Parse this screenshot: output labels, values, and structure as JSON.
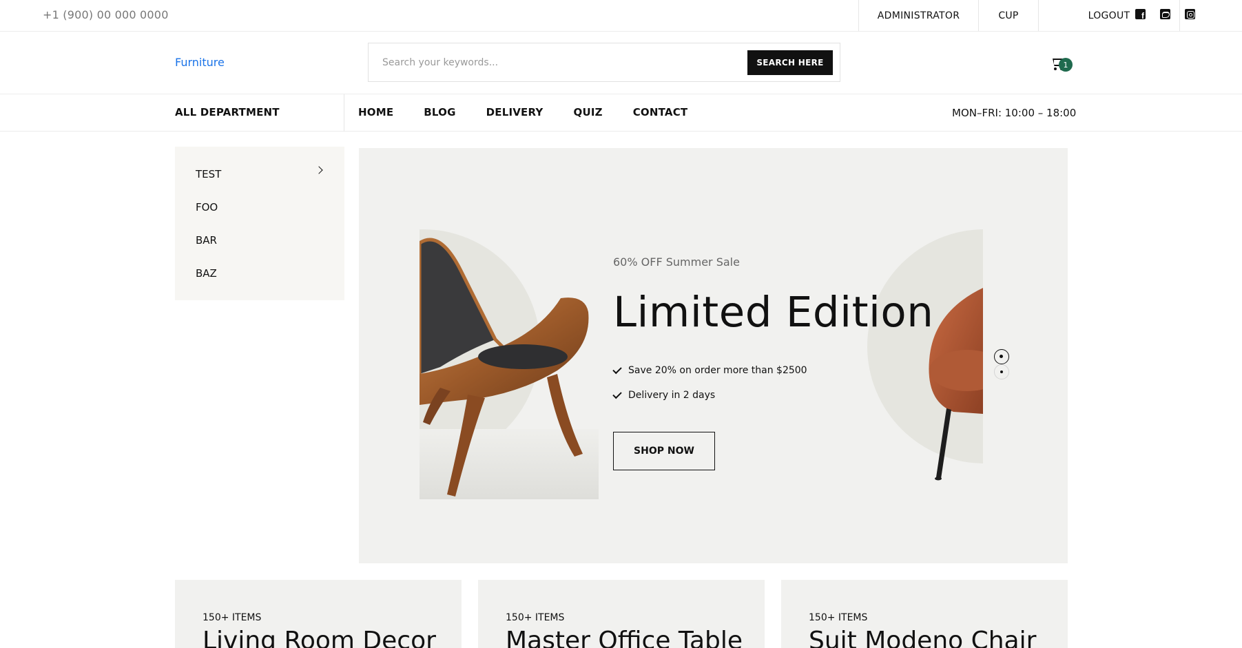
{
  "topbar": {
    "phone": "+1 (900) 00 000 0000",
    "links": {
      "admin": "ADMINISTRATOR",
      "cup": "CUP",
      "logout": "LOGOUT"
    },
    "socials": [
      "facebook-icon",
      "twitter-icon",
      "instagram-icon"
    ]
  },
  "header": {
    "logo": "Furniture",
    "search": {
      "placeholder": "Search your keywords...",
      "button": "SEARCH HERE"
    },
    "cart": {
      "count": "1",
      "badge_color": "#1f6a4e"
    }
  },
  "nav": {
    "all_department": "ALL DEPARTMENT",
    "items": [
      "HOME",
      "BLOG",
      "DELIVERY",
      "QUIZ",
      "CONTACT"
    ],
    "hours": "MON–FRI: 10:00 – 18:00"
  },
  "sidebar": {
    "categories": [
      "TEST",
      "FOO",
      "BAR",
      "BAZ"
    ]
  },
  "hero": {
    "kicker": "60% OFF Summer Sale",
    "headline": "Limited Edition",
    "features": [
      "Save 20% on order more than $2500",
      "Delivery in 2 days"
    ],
    "cta": "SHOP NOW",
    "slides_total": 2,
    "slide_active": 1
  },
  "cards": [
    {
      "count": "150+ ITEMS",
      "title": "Living Room Decor"
    },
    {
      "count": "150+ ITEMS",
      "title": "Master Office Table"
    },
    {
      "count": "150+ ITEMS",
      "title": "Suit Modeno Chair"
    }
  ],
  "colors": {
    "accent_link": "#1a73e8",
    "hero_bg": "#f1f1ef",
    "sidebar_bg": "#f7f6f3"
  }
}
